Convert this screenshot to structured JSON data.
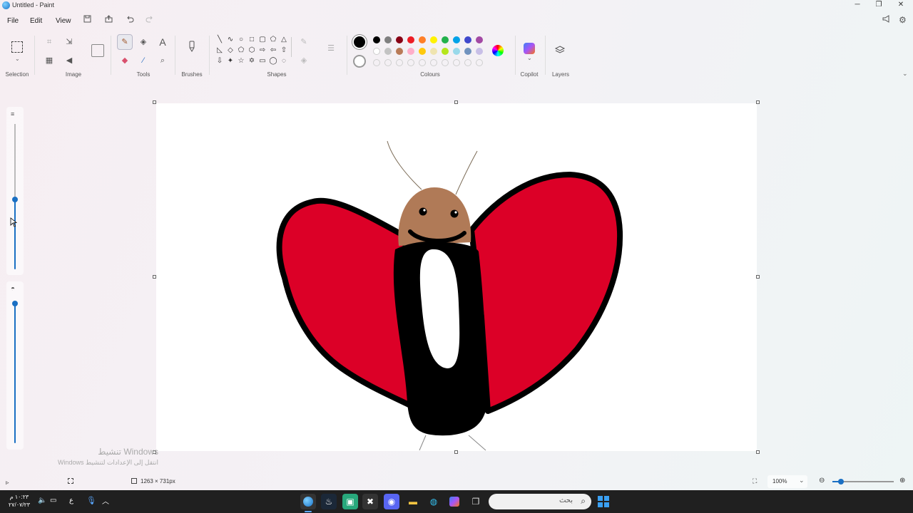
{
  "window": {
    "title": "Untitled - Paint"
  },
  "menu": {
    "file": "File",
    "edit": "Edit",
    "view": "View"
  },
  "ribbon": {
    "groups": {
      "selection": "Selection",
      "image": "Image",
      "tools": "Tools",
      "brushes": "Brushes",
      "shapes": "Shapes",
      "colours": "Colours",
      "copilot": "Copilot",
      "layers": "Layers"
    },
    "palette_row1": [
      "#000000",
      "#7f7f7f",
      "#880015",
      "#ed1c24",
      "#ff7f27",
      "#fff200",
      "#22b14c",
      "#00a2e8",
      "#3f48cc",
      "#a349a4"
    ],
    "palette_row2": [
      "#ffffff",
      "#c3c3c3",
      "#b97a57",
      "#ffaec9",
      "#ffc90e",
      "#efe4b0",
      "#b5e61d",
      "#99d9ea",
      "#7092be",
      "#c8bfe7"
    ],
    "active_colour": "#000000"
  },
  "canvas": {
    "size_label": "1263 × 731px"
  },
  "status": {
    "zoom": "100%"
  },
  "watermark": {
    "line1": "Windows تنشيط",
    "line2": "انتقل إلى الإعدادات لتنشيط Windows"
  },
  "taskbar": {
    "search_placeholder": "بحث",
    "clock_time": "١٠:٢٣ م",
    "clock_date": "٢٧/٠٧/٢٣",
    "lang": "ع"
  },
  "icons": [
    "app-icon",
    "save-icon",
    "share-icon",
    "undo-icon",
    "redo-icon",
    "pencil-icon",
    "fill-icon",
    "text-icon",
    "eraser-icon",
    "picker-icon",
    "magnifier-icon",
    "brush-icon",
    "copilot-icon",
    "layers-icon",
    "settings-icon",
    "feedback-icon"
  ]
}
